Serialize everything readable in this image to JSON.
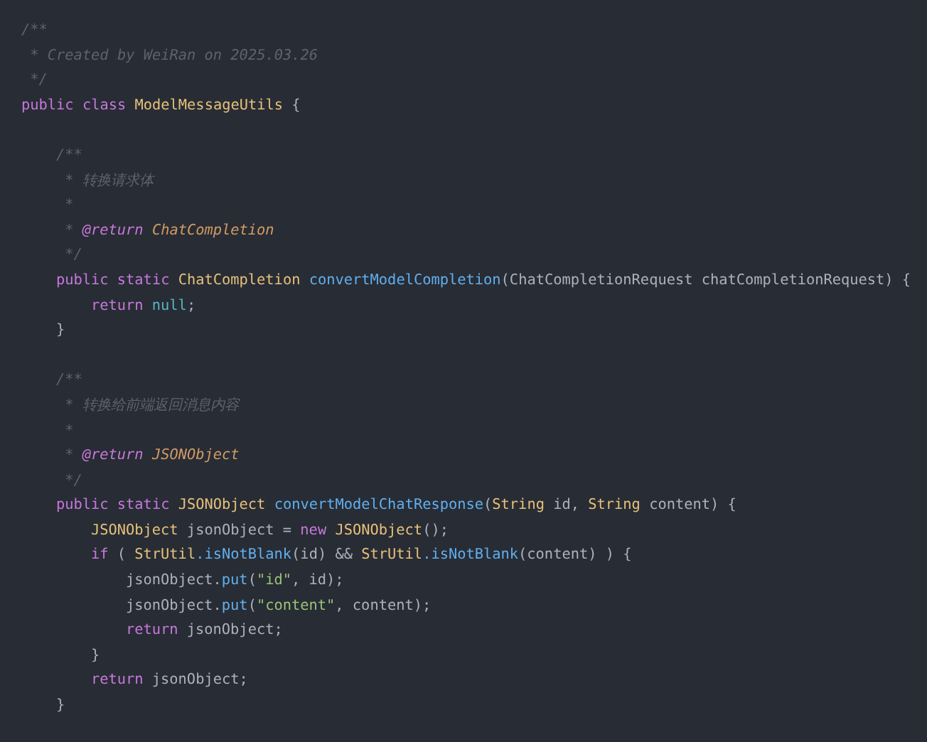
{
  "editor": {
    "lines": [
      {
        "tokens": [
          {
            "text": "/**",
            "kind": "comment"
          }
        ]
      },
      {
        "tokens": [
          {
            "text": " * Created by WeiRan on 2025.03.26",
            "kind": "comment"
          }
        ]
      },
      {
        "tokens": [
          {
            "text": " */",
            "kind": "comment"
          }
        ]
      },
      {
        "tokens": [
          {
            "text": "public ",
            "kind": "keyword"
          },
          {
            "text": "class ",
            "kind": "keyword"
          },
          {
            "text": "ModelMessageUtils",
            "kind": "type"
          },
          {
            "text": " {",
            "kind": "plain"
          }
        ]
      },
      {
        "gap_before": true,
        "tokens": [
          {
            "text": "    /**",
            "kind": "comment"
          }
        ]
      },
      {
        "tokens": [
          {
            "text": "     * 转换请求体",
            "kind": "comment"
          }
        ]
      },
      {
        "tokens": [
          {
            "text": "     *",
            "kind": "comment"
          }
        ]
      },
      {
        "tokens": [
          {
            "text": "     * ",
            "kind": "comment"
          },
          {
            "text": "@return",
            "kind": "tag"
          },
          {
            "text": " ChatCompletion",
            "kind": "doctype"
          }
        ]
      },
      {
        "tokens": [
          {
            "text": "     */",
            "kind": "comment"
          }
        ]
      },
      {
        "tokens": [
          {
            "text": "    public ",
            "kind": "keyword"
          },
          {
            "text": "static ",
            "kind": "keyword"
          },
          {
            "text": "ChatCompletion ",
            "kind": "type"
          },
          {
            "text": "convertModelCompletion",
            "kind": "func"
          },
          {
            "text": "(ChatCompletionRequest chatCompletionRequest) {",
            "kind": "plain"
          }
        ]
      },
      {
        "tokens": [
          {
            "text": "        return ",
            "kind": "keyword"
          },
          {
            "text": "null",
            "kind": "literal"
          },
          {
            "text": ";",
            "kind": "plain"
          }
        ]
      },
      {
        "tokens": [
          {
            "text": "    }",
            "kind": "plain"
          }
        ]
      },
      {
        "gap_before": true,
        "tokens": [
          {
            "text": "    /**",
            "kind": "comment"
          }
        ]
      },
      {
        "tokens": [
          {
            "text": "     * 转换给前端返回消息内容",
            "kind": "comment"
          }
        ]
      },
      {
        "tokens": [
          {
            "text": "     *",
            "kind": "comment"
          }
        ]
      },
      {
        "tokens": [
          {
            "text": "     * ",
            "kind": "comment"
          },
          {
            "text": "@return",
            "kind": "tag"
          },
          {
            "text": " JSONObject",
            "kind": "doctype"
          }
        ]
      },
      {
        "tokens": [
          {
            "text": "     */",
            "kind": "comment"
          }
        ]
      },
      {
        "tokens": [
          {
            "text": "    public ",
            "kind": "keyword"
          },
          {
            "text": "static ",
            "kind": "keyword"
          },
          {
            "text": "JSONObject ",
            "kind": "type"
          },
          {
            "text": "convertModelChatResponse",
            "kind": "func"
          },
          {
            "text": "(",
            "kind": "plain"
          },
          {
            "text": "String",
            "kind": "type"
          },
          {
            "text": " id, ",
            "kind": "plain"
          },
          {
            "text": "String",
            "kind": "type"
          },
          {
            "text": " content) {",
            "kind": "plain"
          }
        ]
      },
      {
        "tokens": [
          {
            "text": "        JSONObject",
            "kind": "type"
          },
          {
            "text": " jsonObject = ",
            "kind": "plain"
          },
          {
            "text": "new ",
            "kind": "keyword"
          },
          {
            "text": "JSONObject",
            "kind": "type"
          },
          {
            "text": "();",
            "kind": "plain"
          }
        ]
      },
      {
        "tokens": [
          {
            "text": "        if",
            "kind": "keyword"
          },
          {
            "text": " ( ",
            "kind": "plain"
          },
          {
            "text": "StrUtil",
            "kind": "type"
          },
          {
            "text": ".isNotBlank",
            "kind": "func"
          },
          {
            "text": "(id) && ",
            "kind": "plain"
          },
          {
            "text": "StrUtil",
            "kind": "type"
          },
          {
            "text": ".isNotBlank",
            "kind": "func"
          },
          {
            "text": "(content) ) {",
            "kind": "plain"
          }
        ]
      },
      {
        "tokens": [
          {
            "text": "            jsonObject.",
            "kind": "plain"
          },
          {
            "text": "put",
            "kind": "func"
          },
          {
            "text": "(",
            "kind": "plain"
          },
          {
            "text": "\"id\"",
            "kind": "string"
          },
          {
            "text": ", id);",
            "kind": "plain"
          }
        ]
      },
      {
        "tokens": [
          {
            "text": "            jsonObject.",
            "kind": "plain"
          },
          {
            "text": "put",
            "kind": "func"
          },
          {
            "text": "(",
            "kind": "plain"
          },
          {
            "text": "\"content\"",
            "kind": "string"
          },
          {
            "text": ", content);",
            "kind": "plain"
          }
        ]
      },
      {
        "tokens": [
          {
            "text": "            return",
            "kind": "keyword"
          },
          {
            "text": " jsonObject;",
            "kind": "plain"
          }
        ]
      },
      {
        "tokens": [
          {
            "text": "        }",
            "kind": "plain"
          }
        ]
      },
      {
        "tokens": [
          {
            "text": "        return",
            "kind": "keyword"
          },
          {
            "text": " jsonObject;",
            "kind": "plain"
          }
        ]
      },
      {
        "tokens": [
          {
            "text": "    }",
            "kind": "plain"
          }
        ]
      }
    ]
  }
}
